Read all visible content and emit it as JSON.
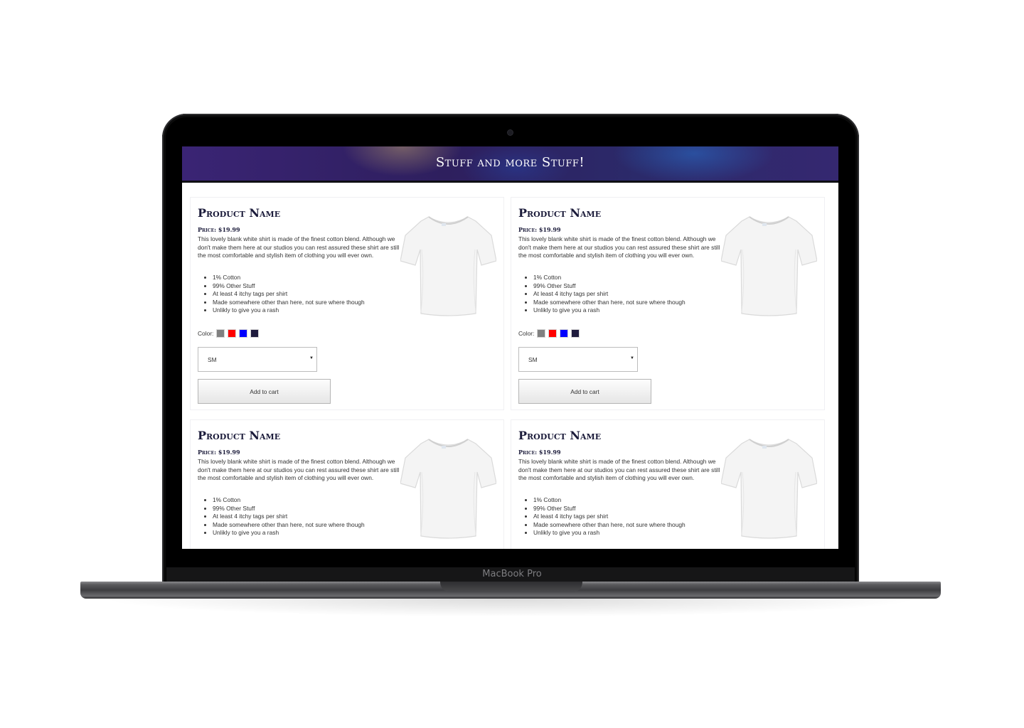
{
  "device": {
    "label": "MacBook Pro"
  },
  "site": {
    "title": "Stuff and more Stuff!"
  },
  "products": [
    {
      "name": "Product Name",
      "price": "Price: $19.99",
      "description": "This lovely blank white shirt is made of the finest cotton blend. Although we don't make them here at our studios you can rest assured these shirt are still the most comfortable and stylish item of clothing you will ever own.",
      "features": [
        "1% Cotton",
        "99% Other Stuff",
        "At least 4 itchy tags per shirt",
        "Made somewhere other than here, not sure where though",
        "Unlikly to give you a rash"
      ],
      "color_label": "Color:",
      "colors": [
        "#808080",
        "#ff0000",
        "#0000ff",
        "#1e1a3d"
      ],
      "size": "SM",
      "cart_label": "Add to cart",
      "image_icon": "white-tshirt"
    },
    {
      "name": "Product Name",
      "price": "Price: $19.99",
      "description": "This lovely blank white shirt is made of the finest cotton blend. Although we don't make them here at our studios you can rest assured these shirt are still the most comfortable and stylish item of clothing you will ever own.",
      "features": [
        "1% Cotton",
        "99% Other Stuff",
        "At least 4 itchy tags per shirt",
        "Made somewhere other than here, not sure where though",
        "Unlikly to give you a rash"
      ],
      "color_label": "Color:",
      "colors": [
        "#808080",
        "#ff0000",
        "#0000ff",
        "#1e1a3d"
      ],
      "size": "SM",
      "cart_label": "Add to cart",
      "image_icon": "white-tshirt"
    },
    {
      "name": "Product Name",
      "price": "Price: $19.99",
      "description": "This lovely blank white shirt is made of the finest cotton blend. Although we don't make them here at our studios you can rest assured these shirt are still the most comfortable and stylish item of clothing you will ever own.",
      "features": [
        "1% Cotton",
        "99% Other Stuff",
        "At least 4 itchy tags per shirt",
        "Made somewhere other than here, not sure where though",
        "Unlikly to give you a rash"
      ],
      "image_icon": "white-tshirt"
    },
    {
      "name": "Product Name",
      "price": "Price: $19.99",
      "description": "This lovely blank white shirt is made of the finest cotton blend. Although we don't make them here at our studios you can rest assured these shirt are still the most comfortable and stylish item of clothing you will ever own.",
      "features": [
        "1% Cotton",
        "99% Other Stuff",
        "At least 4 itchy tags per shirt",
        "Made somewhere other than here, not sure where though",
        "Unlikly to give you a rash"
      ],
      "image_icon": "white-tshirt"
    }
  ]
}
